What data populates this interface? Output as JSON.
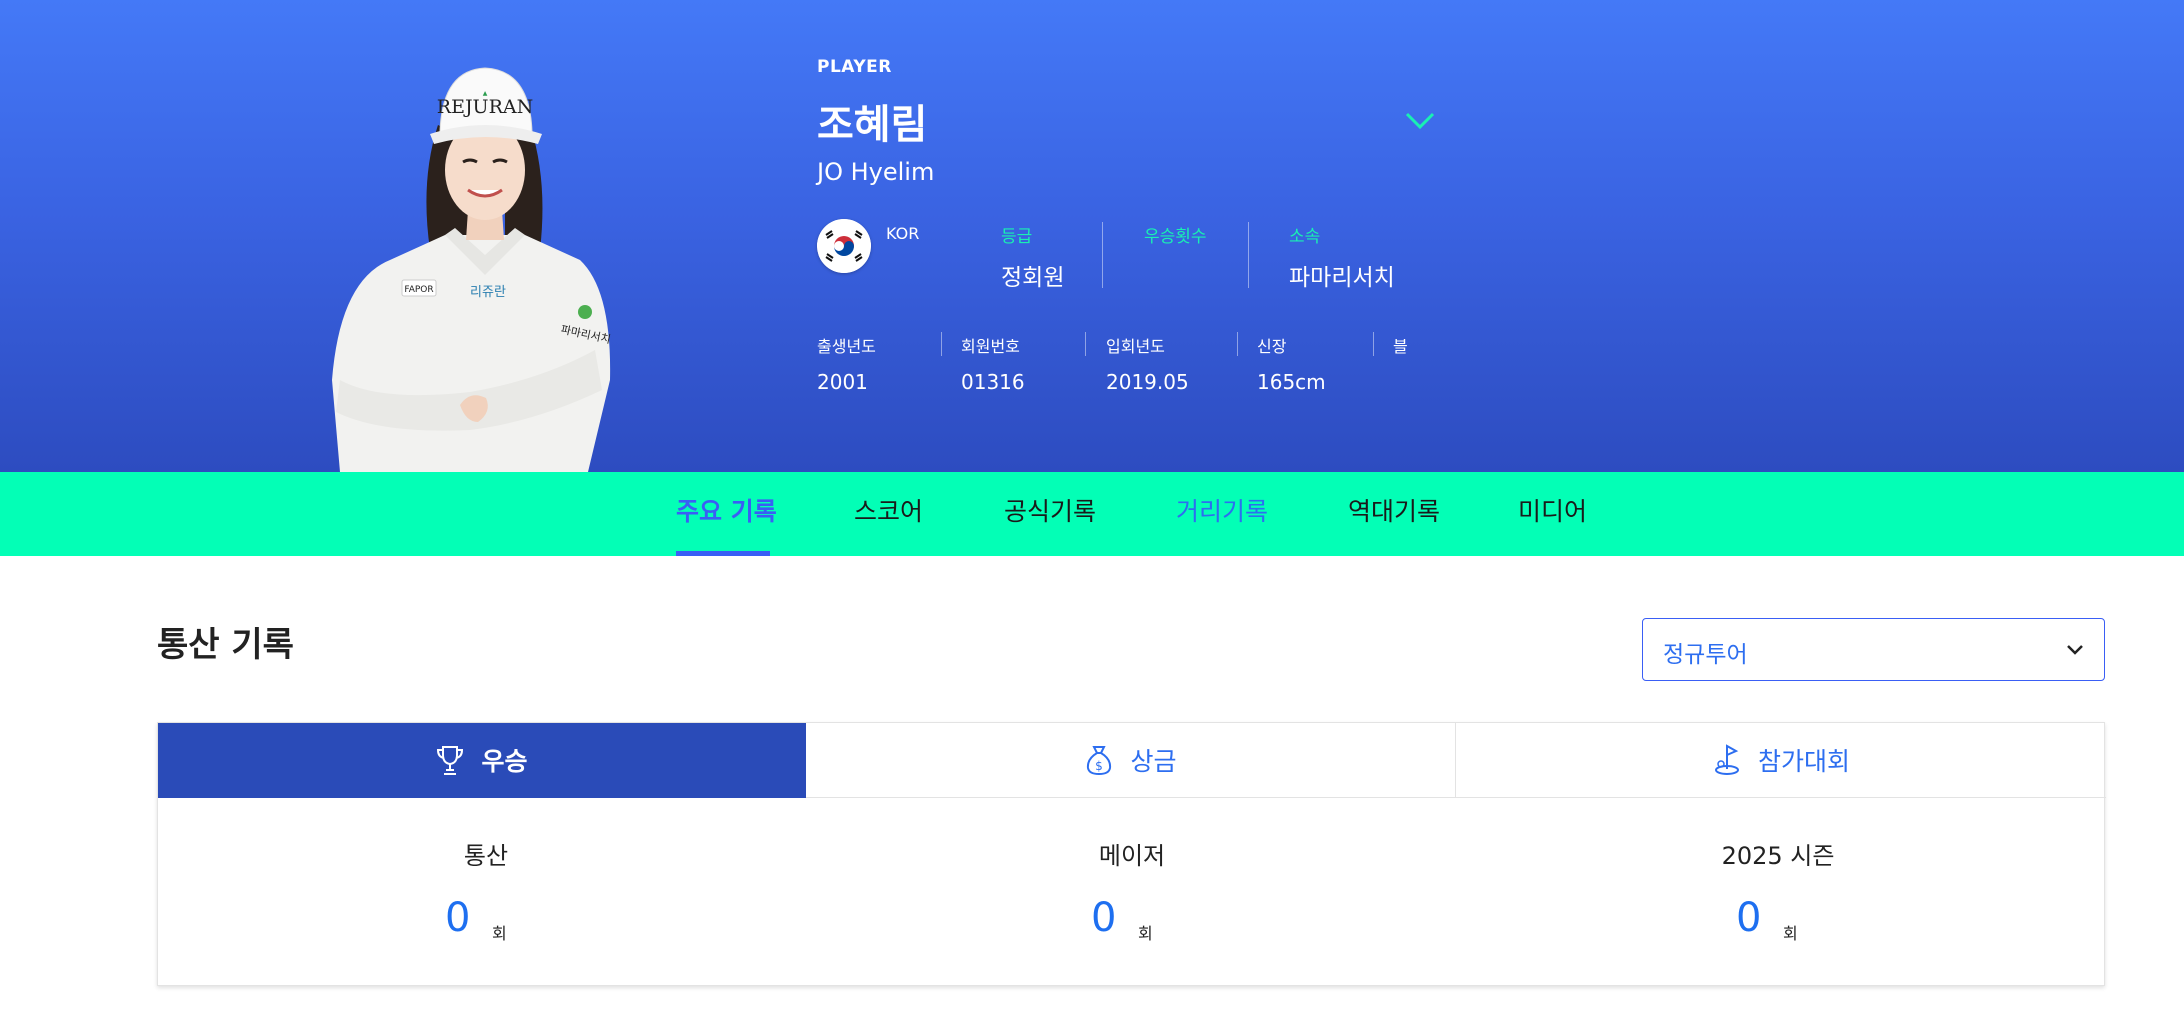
{
  "player": {
    "label": "PLAYER",
    "name_ko": "조혜림",
    "name_en": "JO Hyelim",
    "nation": "KOR",
    "photo_text": {
      "cap": "REJURAN",
      "chest_left": "FAPOR",
      "chest_right": "리쥬란",
      "sleeve": "파마리서치"
    }
  },
  "info": {
    "grade_label": "등급",
    "grade_value": "정회원",
    "wins_label": "우승횟수",
    "wins_value": "",
    "team_label": "소속",
    "team_value": "파마리서치"
  },
  "stats": [
    {
      "label": "출생년도",
      "value": "2001"
    },
    {
      "label": "회원번호",
      "value": "01316"
    },
    {
      "label": "입회년도",
      "value": "2019.05"
    },
    {
      "label": "신장",
      "value": "165cm"
    },
    {
      "label": "블",
      "value": ""
    }
  ],
  "tabs": [
    "주요 기록",
    "스코어",
    "공식기록",
    "거리기록",
    "역대기록",
    "미디어"
  ],
  "section": {
    "title": "통산 기록",
    "select_value": "정규투어"
  },
  "record_tabs": [
    {
      "label": "우승",
      "icon": "trophy-icon"
    },
    {
      "label": "상금",
      "icon": "money-bag-icon"
    },
    {
      "label": "참가대회",
      "icon": "golf-flag-icon"
    }
  ],
  "metrics": [
    {
      "title": "통산",
      "value": "0",
      "unit": "회"
    },
    {
      "title": "메이저",
      "value": "0",
      "unit": "회"
    },
    {
      "title": "2025 시즌",
      "value": "0",
      "unit": "회"
    }
  ],
  "colors": {
    "hero_top": "#4479f7",
    "hero_bottom": "#2d4cc0",
    "accent_mint": "#03ffb6",
    "label_mint": "#19f0b3",
    "active_blue": "#3a5ef5",
    "value_blue": "#1e6ff0",
    "tab_active_bg": "#2a4bb8"
  }
}
